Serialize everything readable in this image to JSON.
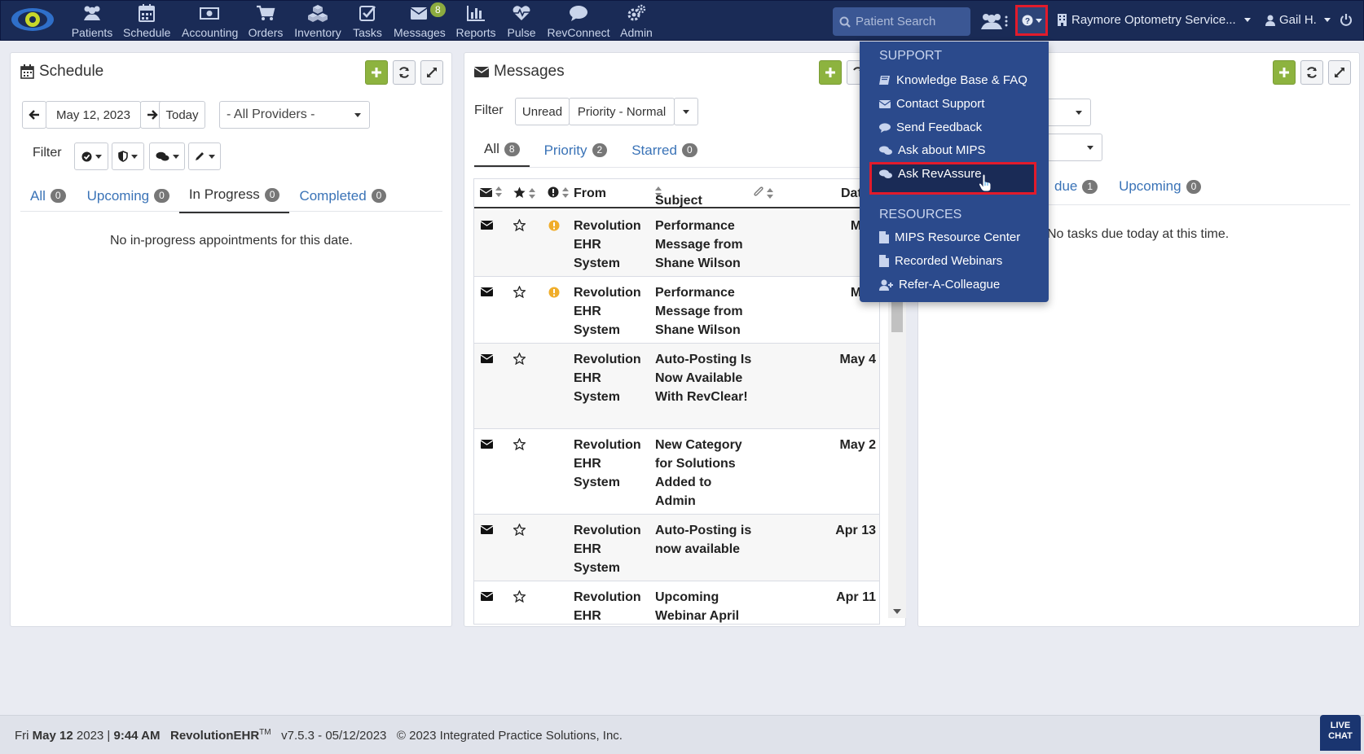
{
  "nav": {
    "items": [
      {
        "label": "Patients",
        "icon": "users-icon"
      },
      {
        "label": "Schedule",
        "icon": "calendar-icon"
      },
      {
        "label": "Accounting",
        "icon": "money-icon"
      },
      {
        "label": "Orders",
        "icon": "cart-icon"
      },
      {
        "label": "Inventory",
        "icon": "cubes-icon"
      },
      {
        "label": "Tasks",
        "icon": "checkbox-icon"
      },
      {
        "label": "Messages",
        "icon": "envelope-icon"
      },
      {
        "label": "Reports",
        "icon": "bar-chart-icon"
      },
      {
        "label": "Pulse",
        "icon": "heartbeat-icon"
      },
      {
        "label": "RevConnect",
        "icon": "chat-icon"
      },
      {
        "label": "Admin",
        "icon": "cogs-icon"
      }
    ],
    "messages_badge": "8",
    "search_placeholder": "Patient Search",
    "org": "Raymore Optometry Service...",
    "user": "Gail H."
  },
  "schedule": {
    "title": "Schedule",
    "date": "May 12, 2023",
    "today_label": "Today",
    "provider": "- All Providers -",
    "filter_label": "Filter",
    "tabs": [
      {
        "label": "All",
        "count": "0"
      },
      {
        "label": "Upcoming",
        "count": "0"
      },
      {
        "label": "In Progress",
        "count": "0"
      },
      {
        "label": "Completed",
        "count": "0"
      }
    ],
    "empty_text": "No in-progress appointments for this date."
  },
  "messages": {
    "title": "Messages",
    "filter_label": "Filter",
    "filter_unread": "Unread",
    "filter_priority": "Priority - Normal",
    "tabs": [
      {
        "label": "All",
        "count": "8"
      },
      {
        "label": "Priority",
        "count": "2"
      },
      {
        "label": "Starred",
        "count": "0"
      }
    ],
    "columns": {
      "from": "From",
      "subject": "Subject",
      "date": "Date"
    },
    "rows": [
      {
        "from": "Revolution EHR System",
        "subject": "Performance Message from Shane Wilson",
        "date": "May",
        "priority": true
      },
      {
        "from": "Revolution EHR System",
        "subject": "Performance Message from Shane Wilson",
        "date": "May",
        "priority": true
      },
      {
        "from": "Revolution EHR System",
        "subject": "Auto-Posting Is Now Available With RevClear!",
        "date": "May 4",
        "priority": false
      },
      {
        "from": "Revolution EHR System",
        "subject": "New Category for Solutions Added to Admin",
        "date": "May 2",
        "priority": false
      },
      {
        "from": "Revolution EHR System",
        "subject": "Auto-Posting is now available",
        "date": "Apr 13",
        "priority": false
      },
      {
        "from": "Revolution EHR",
        "subject": "Upcoming Webinar April",
        "date": "Apr 11",
        "priority": false
      }
    ]
  },
  "tasks": {
    "tab_overdue": "due",
    "tab_overdue_count": "1",
    "tab_upcoming": "Upcoming",
    "tab_upcoming_count": "0",
    "empty_text": "No tasks due today at this time."
  },
  "help_menu": {
    "support_header": "SUPPORT",
    "support_items": [
      "Knowledge Base & FAQ",
      "Contact Support",
      "Send Feedback",
      "Ask about MIPS",
      "Ask RevAssure"
    ],
    "resources_header": "RESOURCES",
    "resource_items": [
      "MIPS Resource Center",
      "Recorded Webinars",
      "Refer-A-Colleague"
    ]
  },
  "footer": {
    "day": "Fri",
    "date_bold": "May 12",
    "year": "2023",
    "time": "9:44 AM",
    "product": "RevolutionEHR",
    "tm": "TM",
    "version": "v7.5.3 - 05/12/2023",
    "copyright": "© 2023 Integrated Practice Solutions, Inc."
  },
  "livechat": {
    "line1": "LIVE",
    "line2": "CHAT"
  },
  "colors": {
    "navbar": "#1a2b56",
    "accent_green": "#8db33f",
    "link_blue": "#3a73b7",
    "highlight_red": "#e21b2b",
    "dropdown_bg": "#2b4a8c"
  }
}
